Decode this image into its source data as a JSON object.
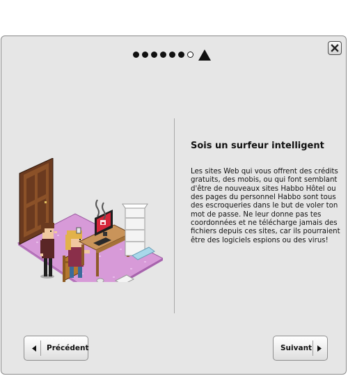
{
  "dialog": {
    "close_icon": "close-x-icon",
    "pager": {
      "total_steps": 7,
      "current_step": 7,
      "end_icon": "triangle-icon"
    },
    "title": "Sois un surfeur intelligent",
    "body": "Les sites Web qui vous offrent des crédits gratuits, des mobis, ou qui font semblant d'être de nouveaux sites Habbo Hôtel ou des pages du personnel Habbo sont tous des escroqueries dans le but de voler ton mot de passe. Ne leur donne pas tes coordonnées et ne télécharge jamais des fichiers depuis ces sites, car ils pourraient être des logiciels espions ou des virus!",
    "illustration": "habbo-room-computer-illustration",
    "prev_button": {
      "label": "Précédent",
      "icon": "arrow-left-icon"
    },
    "next_button": {
      "label": "Suivant",
      "icon": "arrow-right-icon"
    }
  },
  "colors": {
    "panel_bg": "#e6e6e6",
    "rug": "#d79ad8",
    "desk": "#c9945a",
    "screen": "#d6263a"
  }
}
